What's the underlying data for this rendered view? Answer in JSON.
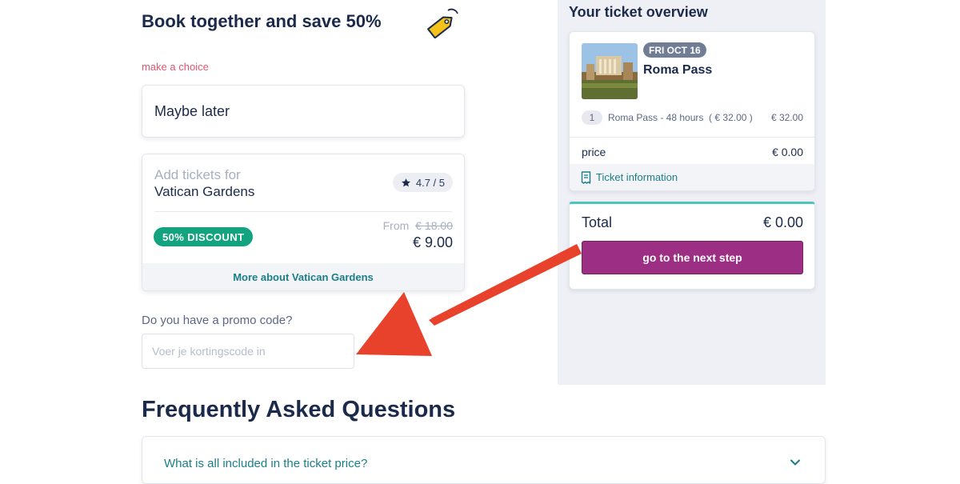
{
  "booking": {
    "heading": "Book together and save 50%",
    "tag_icon": "price-tag-icon",
    "make_choice": "make a choice",
    "maybe_later": "Maybe later",
    "addon": {
      "add_label": "Add tickets for",
      "name": "Vatican Gardens",
      "rating": "4.7 / 5",
      "discount_badge": "50% DISCOUNT",
      "from_label": "From",
      "old_price": "€ 18.00",
      "new_price": "€ 9.00",
      "more_link": "More about Vatican Gardens"
    },
    "promo": {
      "label": "Do you have a promo code?",
      "placeholder": "Voer je kortingscode in",
      "value": ""
    }
  },
  "faq": {
    "title": "Frequently Asked Questions",
    "items": [
      {
        "question": "What is all included in the ticket price?"
      }
    ]
  },
  "overview": {
    "title": "Your ticket overview",
    "ticket": {
      "date_badge": "FRI OCT 16",
      "name": "Roma Pass",
      "lines": [
        {
          "qty": "1",
          "description": "Roma Pass - 48 hours  ( € 32.00 )",
          "amount": "€ 32.00"
        }
      ],
      "price_label": "price",
      "price_value": "€ 0.00",
      "info_link": "Ticket information"
    },
    "total_label": "Total",
    "total_value": "€ 0.00",
    "next_button": "go to the next step"
  },
  "colors": {
    "accent_teal": "#1b7e87",
    "discount_green": "#14a37f",
    "cta_purple": "#9c2e83",
    "annotation_arrow": "#e8412c"
  }
}
